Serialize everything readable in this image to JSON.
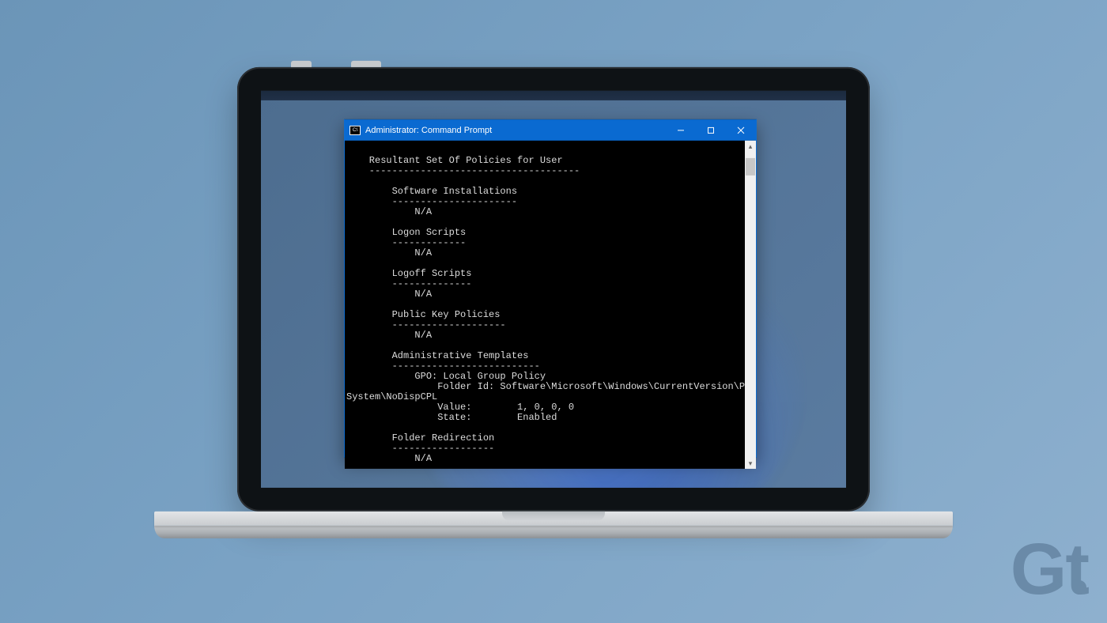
{
  "window": {
    "title": "Administrator: Command Prompt",
    "icon_label": "C:\\"
  },
  "terminal": {
    "header": "Resultant Set Of Policies for User",
    "header_dashes": "-------------------------------------",
    "sections": [
      {
        "title": "Software Installations",
        "dashes": "----------------------",
        "value": "N/A"
      },
      {
        "title": "Logon Scripts",
        "dashes": "-------------",
        "value": "N/A"
      },
      {
        "title": "Logoff Scripts",
        "dashes": "--------------",
        "value": "N/A"
      },
      {
        "title": "Public Key Policies",
        "dashes": "--------------------",
        "value": "N/A"
      }
    ],
    "admin_templates": {
      "title": "Administrative Templates",
      "dashes": "--------------------------",
      "gpo_label": "GPO: Local Group Policy",
      "folder_id_label": "Folder Id:",
      "folder_id_value": "Software\\Microsoft\\Windows\\CurrentVersion\\Policies\\",
      "folder_id_wrap": "System\\NoDispCPL",
      "value_label": "Value:",
      "value": "1, 0, 0, 0",
      "state_label": "State:",
      "state": "Enabled"
    },
    "folder_redirection": {
      "title": "Folder Redirection",
      "dashes": "------------------",
      "value": "N/A"
    }
  },
  "watermark": {
    "g": "G",
    "t": "t"
  }
}
